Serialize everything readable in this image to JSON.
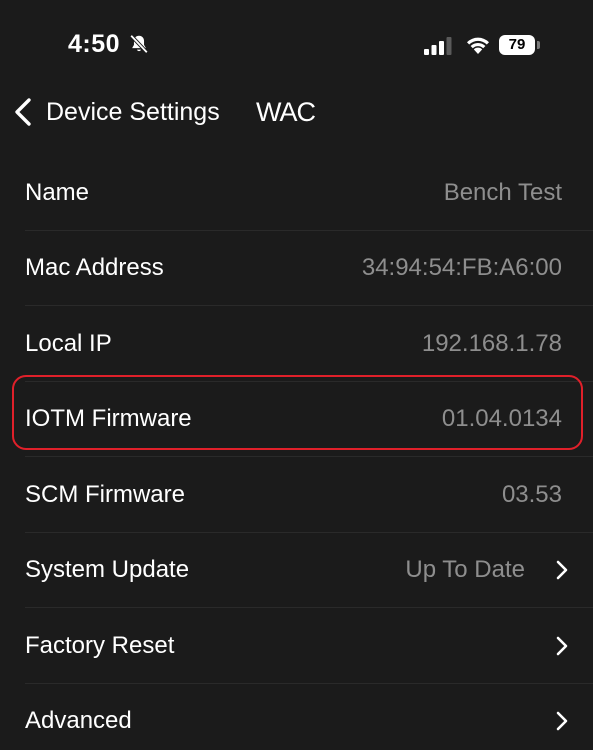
{
  "status_bar": {
    "time": "4:50",
    "battery_level": "79",
    "icons": [
      "bell-slash-icon",
      "cellular-signal-icon",
      "wifi-icon",
      "battery-icon"
    ]
  },
  "nav": {
    "back_label": "Device Settings",
    "brand": "WAC"
  },
  "rows": [
    {
      "label": "Name",
      "value": "Bench Test"
    },
    {
      "label": "Mac Address",
      "value": "34:94:54:FB:A6:00"
    },
    {
      "label": "Local IP",
      "value": "192.168.1.78"
    },
    {
      "label": "IOTM Firmware",
      "value": "01.04.0134"
    },
    {
      "label": "SCM Firmware",
      "value": "03.53"
    },
    {
      "label": "System Update",
      "value": "Up To Date"
    },
    {
      "label": "Factory Reset",
      "value": ""
    },
    {
      "label": "Advanced",
      "value": ""
    }
  ],
  "colors": {
    "background": "#1b1b1b",
    "label": "#ffffff",
    "value": "#8e8e8e",
    "highlight": "#e0202a"
  }
}
